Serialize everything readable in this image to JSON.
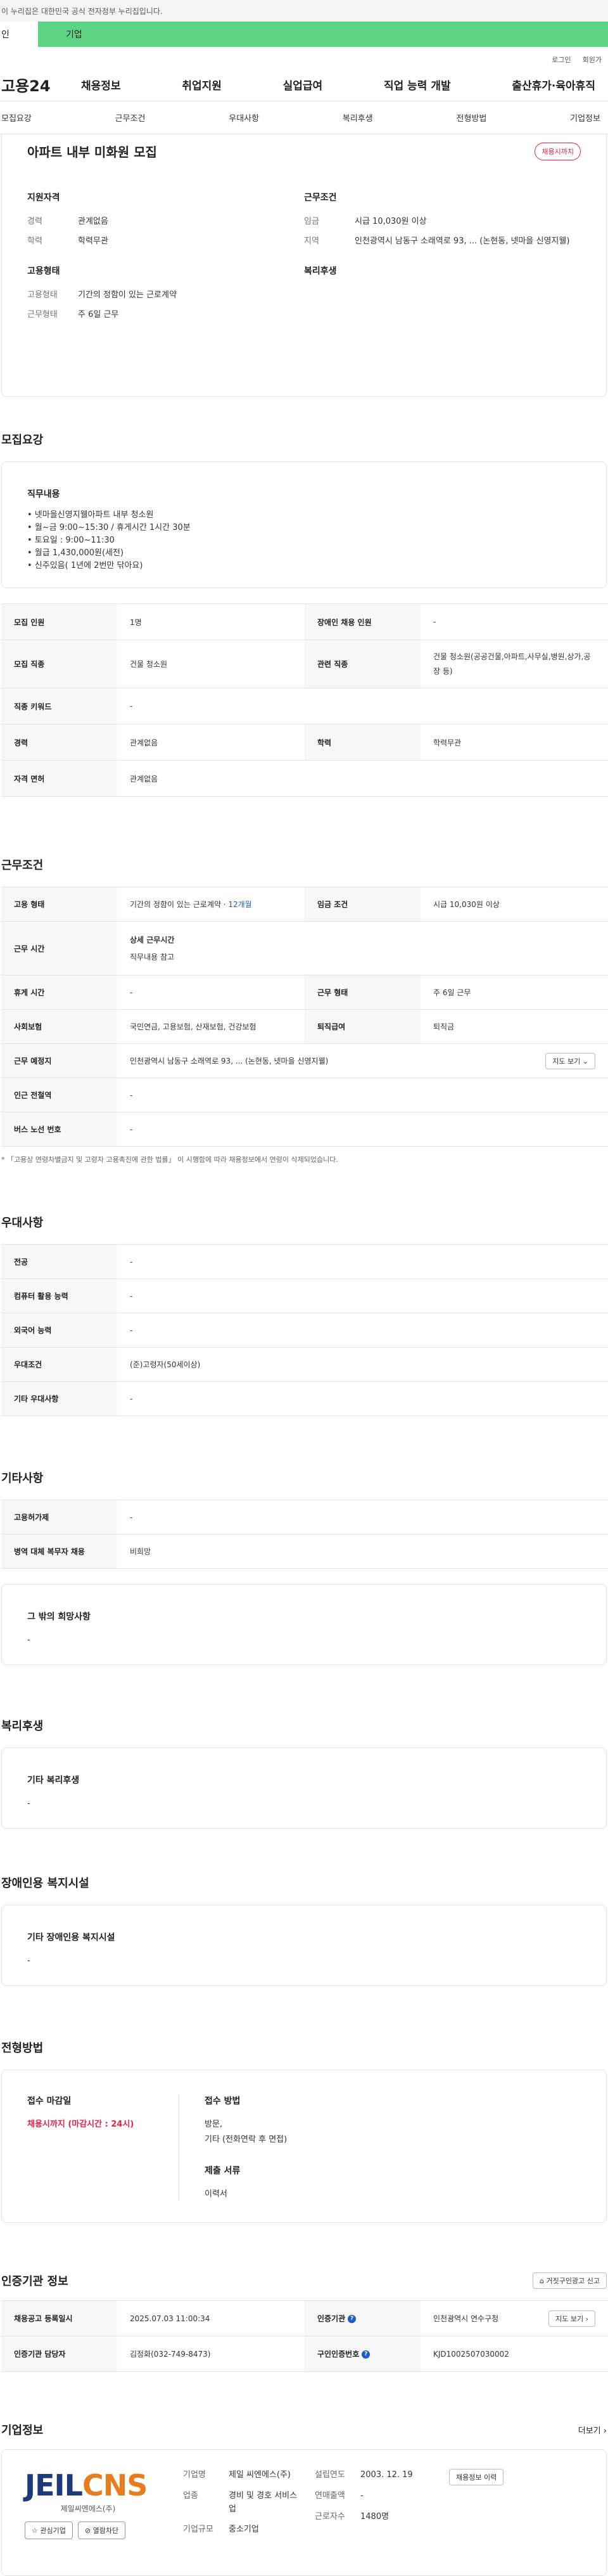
{
  "gov_banner": "이 누리집은 대한민국 공식 전자정부 누리집입니다.",
  "top_tabs": {
    "person": "인",
    "company": "기업"
  },
  "util": {
    "login": "로그인",
    "join": "회원가"
  },
  "logo": "고용24",
  "gnb": [
    "채용정보",
    "취업지원",
    "실업급여",
    "직업 능력 개발",
    "출산휴가·육아휴직"
  ],
  "anchors": [
    "모집요강",
    "근무조건",
    "우대사항",
    "복리후생",
    "전형방법",
    "기업정보"
  ],
  "header": {
    "title": "아파트 내부 미화원 모집",
    "badge": "채용시까지",
    "qual": {
      "title": "지원자격",
      "rows": [
        {
          "k": "경력",
          "v": "관계없음"
        },
        {
          "k": "학력",
          "v": "학력무관"
        }
      ]
    },
    "emp": {
      "title": "고용형태",
      "rows": [
        {
          "k": "고용형태",
          "v": "기간의 정함이 있는 근로계약"
        },
        {
          "k": "근무형태",
          "v": "주 6일 근무"
        }
      ]
    },
    "cond": {
      "title": "근무조건",
      "rows": [
        {
          "k": "임금",
          "v": "시급 10,030원 이상"
        },
        {
          "k": "지역",
          "v": "인천광역시 남동구 소래역로 93, ... (논현동, 넷마을 신영지웰)"
        }
      ]
    },
    "welfare_title": "복리후생"
  },
  "recruit": {
    "title": "모집요강",
    "duty_title": "직무내용",
    "duty_lines": [
      "• 넷마을신영지웰아파트 내부 청소원",
      "• 월~금 9:00~15:30 / 휴게시간 1시간 30분",
      "• 토요일 : 9:00~11:30",
      "• 월급 1,430,000원(세전)",
      "• 신주있음( 1년에 2번만 닦아요)"
    ],
    "rows": [
      {
        "k1": "모집 인원",
        "v1": "1명",
        "k2": "장애인 채용 인원",
        "v2": "-"
      },
      {
        "k1": "모집 직종",
        "v1": "건물 청소원",
        "k2": "관련 직종",
        "v2": "건물 청소원(공공건물,아파트,사무실,병원,상가,공장 등)"
      },
      {
        "k1": "직종 키워드",
        "v1": "-"
      },
      {
        "k1": "경력",
        "v1": "관계없음",
        "k2": "학력",
        "v2": "학력무관"
      },
      {
        "k1": "자격 면허",
        "v1": "관계없음"
      }
    ]
  },
  "work": {
    "title": "근무조건",
    "emp_type_k": "고용 형태",
    "emp_type_v": "기간의 정함이 있는 근로계약 · ",
    "emp_type_hl": "12개월",
    "wage_k": "임금 조건",
    "wage_v": "시급 10,030원 이상",
    "hours_k": "근무 시간",
    "hours_title": "상세 근무시간",
    "hours_v": "직무내용 참고",
    "break_k": "휴게 시간",
    "break_v": "-",
    "wtype_k": "근무 형태",
    "wtype_v": "주 6일 근무",
    "ins_k": "사회보험",
    "ins_v": "국민연금, 고용보험, 산재보험, 건강보험",
    "sev_k": "퇴직급여",
    "sev_v": "퇴직금",
    "place_k": "근무 예정지",
    "place_v": "인천광역시 남동구 소래역로 93, ... (논현동, 넷마을 신영지웰)",
    "map_btn": "지도 보기",
    "subway_k": "인근 전철역",
    "subway_v": "-",
    "bus_k": "버스 노선 번호",
    "bus_v": "-",
    "note": "* 「고용상 연령차별금지 및 고령자 고용촉진에 관한 법률」 이 시행함에 따라 채용정보에서 연령이 삭제되었습니다."
  },
  "pref": {
    "title": "우대사항",
    "rows": [
      {
        "k": "전공",
        "v": "-"
      },
      {
        "k": "컴퓨터 활용 능력",
        "v": "-"
      },
      {
        "k": "외국어 능력",
        "v": "-"
      },
      {
        "k": "우대조건",
        "v": "(준)고령자(50세이상)"
      },
      {
        "k": "기타 우대사항",
        "v": "-"
      }
    ]
  },
  "etc": {
    "title": "기타사항",
    "rows": [
      {
        "k": "고용허가제",
        "v": "-"
      },
      {
        "k": "병역 대체 복무자 채용",
        "v": "비희망"
      }
    ],
    "other_title": "그 밖의 희망사항",
    "other_v": "-"
  },
  "welfare": {
    "title": "복리후생",
    "box_title": "기타 복리후생",
    "box_v": "-"
  },
  "disabled": {
    "title": "장애인용 복지시설",
    "box_title": "기타 장애인용 복지시설",
    "box_v": "-"
  },
  "process": {
    "title": "전형방법",
    "deadline_title": "접수 마감일",
    "deadline_v": "채용시까지 (마감시간 : 24시)",
    "method_title": "접수 방법",
    "method_lines": [
      "방문,",
      "기타 (전화연락 후 면접)"
    ],
    "docs_title": "제출 서류",
    "docs_v": "이력서"
  },
  "agency": {
    "title": "인증기관 정보",
    "report_btn": "거짓구인광고 신고",
    "reg_k": "채용공고 등록일시",
    "reg_v": "2025.07.03 11:00:34",
    "cert_k": "인증기관",
    "cert_v": "인천광역시 연수구청",
    "map_btn": "지도 보기",
    "mgr_k": "인증기관 담당자",
    "mgr_v": "김정화(032-749-8473)",
    "no_k": "구인인증번호",
    "no_v": "KJD1002507030002"
  },
  "company": {
    "title": "기업정보",
    "more": "더보기",
    "logo_a": "JEIL",
    "logo_b": "CNS",
    "sub": "제일씨엔에스(주)",
    "fav_btn": "관심기업",
    "block_btn": "열람차단",
    "name_k": "기업명",
    "name_v": "제일 씨엔에스(주)",
    "biz_k": "업종",
    "biz_v": "경비 및 경호 서비스업",
    "size_k": "기업규모",
    "size_v": "중소기업",
    "est_k": "설립연도",
    "est_v": "2003. 12. 19",
    "sales_k": "연매출액",
    "sales_v": "-",
    "emp_k": "근로자수",
    "emp_v": "1480명",
    "info_btn": "채용정보 이력"
  }
}
